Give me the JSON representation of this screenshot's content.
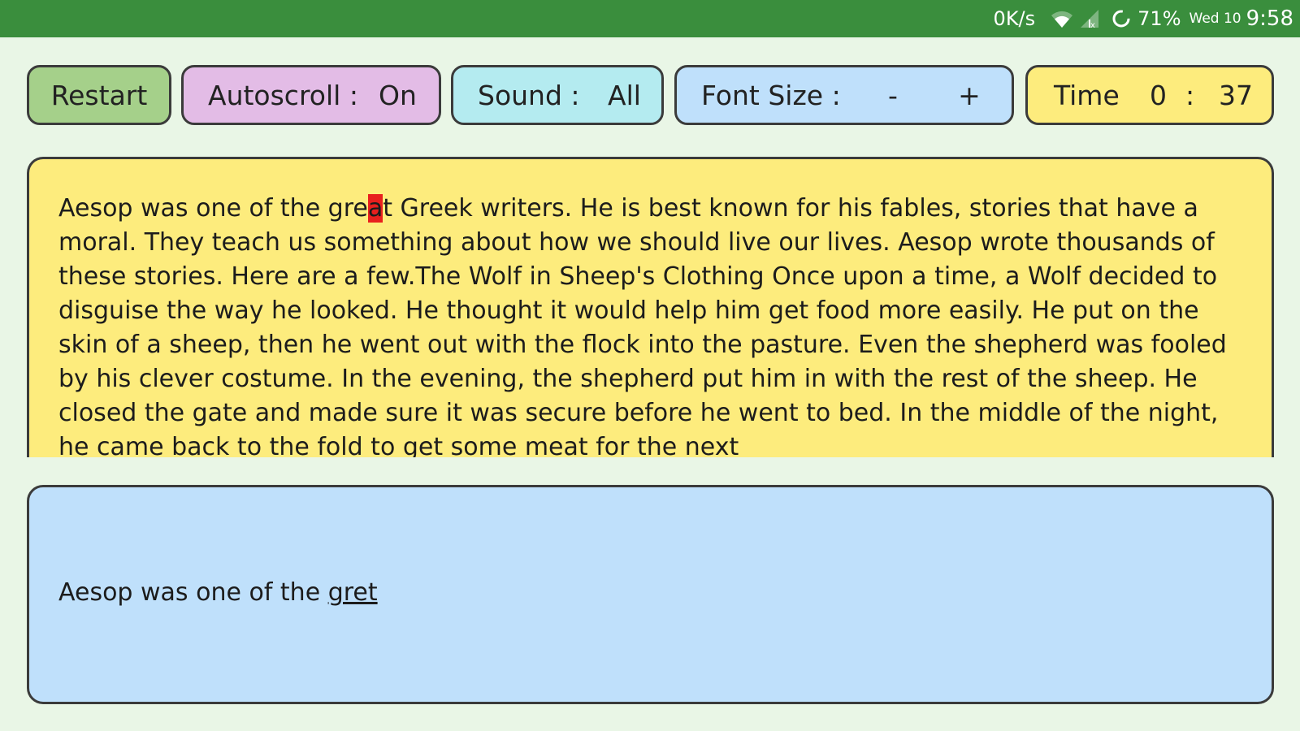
{
  "status_bar": {
    "network_speed": "0K/s",
    "battery": "71%",
    "date": "Wed 10",
    "time": "9:58",
    "icons": [
      "wifi-icon",
      "signal-icon",
      "sync-icon"
    ],
    "background_color": "#3a8e3d"
  },
  "toolbar": {
    "restart_label": "Restart",
    "autoscroll_label": "Autoscroll :",
    "autoscroll_value": "On",
    "sound_label": "Sound :",
    "sound_value": "All",
    "font_size_label": "Font Size :",
    "font_size_decrease": "-",
    "font_size_increase": "+",
    "time_label": "Time",
    "time_minutes": "0",
    "time_separator": ":",
    "time_seconds": "37",
    "colors": {
      "restart": "#a5d08a",
      "autoscroll": "#e3bce6",
      "sound": "#b4ebf0",
      "font_size": "#bfe0fb",
      "time": "#fdec7d"
    }
  },
  "reading": {
    "text_before_cursor": "Aesop was one of the gre",
    "cursor_char": "a",
    "text_after_cursor": "t Greek writers. He is best known for his fables, stories that have a moral. They teach us something about how we should live our lives. Aesop wrote thousands of these stories. Here are a few.The Wolf in Sheep's Clothing Once upon a time, a Wolf decided to disguise the way he looked. He thought it would help him get food more easily. He put on the skin of a sheep, then he went out with the flock into the pasture. Even the shepherd was fooled by his clever costume. In the evening, the shepherd put him in with the rest of the sheep. He closed the gate and made sure it was secure before he went to bed. In the middle of the night, he came back to the fold to get some meat for the next",
    "background_color": "#fdec7d",
    "cursor_color": "#e8201e"
  },
  "typing": {
    "typed_completed": "Aesop was one of the ",
    "typed_current_word": "gret",
    "background_color": "#bfe0fb"
  }
}
